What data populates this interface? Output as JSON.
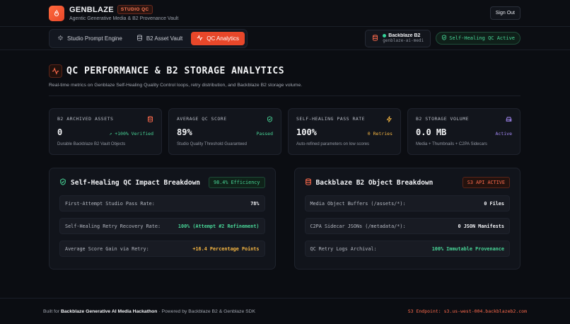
{
  "header": {
    "brand": "GENBLAZE",
    "badge": "STUDIO QC",
    "subtitle": "Agentic Generative Media & B2 Provenance Vault",
    "signout_label": "Sign Out",
    "logo_icon": "flame-icon"
  },
  "nav": {
    "tabs": [
      {
        "label": "Studio Prompt Engine",
        "icon": "sparkle-icon",
        "active": false
      },
      {
        "label": "B2 Asset Vault",
        "icon": "database-icon",
        "active": false
      },
      {
        "label": "QC Analytics",
        "icon": "activity-icon",
        "active": true
      }
    ],
    "bucket": {
      "name": "Backblaze B2",
      "id": "genblaze-ai-media-…",
      "status_color": "#34d399"
    },
    "heal_status": "Self-Healing QC Active"
  },
  "page": {
    "title": "QC PERFORMANCE & B2 STORAGE ANALYTICS",
    "description": "Real-time metrics on Genblaze Self-Healing Quality Control loops, retry distribution, and Backblaze B2 storage volume."
  },
  "stats": [
    {
      "label": "B2 ARCHIVED ASSETS",
      "value": "0",
      "note": "↗ +100% Verified",
      "note_color": "#48d597",
      "desc": "Durable Backblaze B2 Vault Objects",
      "icon": "database-icon",
      "icon_color": "#ff6b4d"
    },
    {
      "label": "AVERAGE QC SCORE",
      "value": "89%",
      "note": "Passed",
      "note_color": "#48d597",
      "desc": "Studio Quality Threshold Guaranteed",
      "icon": "shield-check-icon",
      "icon_color": "#48d597"
    },
    {
      "label": "SELF-HEALING PASS RATE",
      "value": "100%",
      "note": "0 Retries",
      "note_color": "#f5b642",
      "desc": "Auto-refined parameters on low scores",
      "icon": "lightning-icon",
      "icon_color": "#f5b642"
    },
    {
      "label": "B2 STORAGE VOLUME",
      "value": "0.0 MB",
      "note": "Active",
      "note_color": "#a78bfa",
      "desc": "Media + Thumbnails + C2PA Sidecars",
      "icon": "drive-icon",
      "icon_color": "#a78bfa"
    }
  ],
  "qc_panel": {
    "title": "Self-Healing QC Impact Breakdown",
    "badge": "98.4% Efficiency",
    "rows": [
      {
        "label": "First-Attempt Studio Pass Rate:",
        "value": "78%",
        "color": "#f1f2f5"
      },
      {
        "label": "Self-Healing Retry Recovery Rate:",
        "value": "100% (Attempt #2 Refinement)",
        "color": "#48d597"
      },
      {
        "label": "Average Score Gain via Retry:",
        "value": "+16.4 Percentage Points",
        "color": "#f5b642"
      }
    ]
  },
  "b2_panel": {
    "title": "Backblaze B2 Object Breakdown",
    "badge": "S3 API ACTIVE",
    "rows": [
      {
        "label": "Media Object Buffers (/assets/*):",
        "value": "0 Files",
        "color": "#f1f2f5"
      },
      {
        "label": "C2PA Sidecar JSONs (/metadata/*):",
        "value": "0 JSON Manifests",
        "color": "#f1f2f5"
      },
      {
        "label": "QC Retry Logs Archival:",
        "value": "100% Immutable Provenance",
        "color": "#48d597"
      }
    ]
  },
  "footer": {
    "prefix": "Built for ",
    "event": "Backblaze Generative AI Media Hackathon",
    "suffix": " · Powered by Backblaze B2 & Genblaze SDK",
    "endpoint": "S3 Endpoint: s3.us-west-004.backblazeb2.com"
  }
}
